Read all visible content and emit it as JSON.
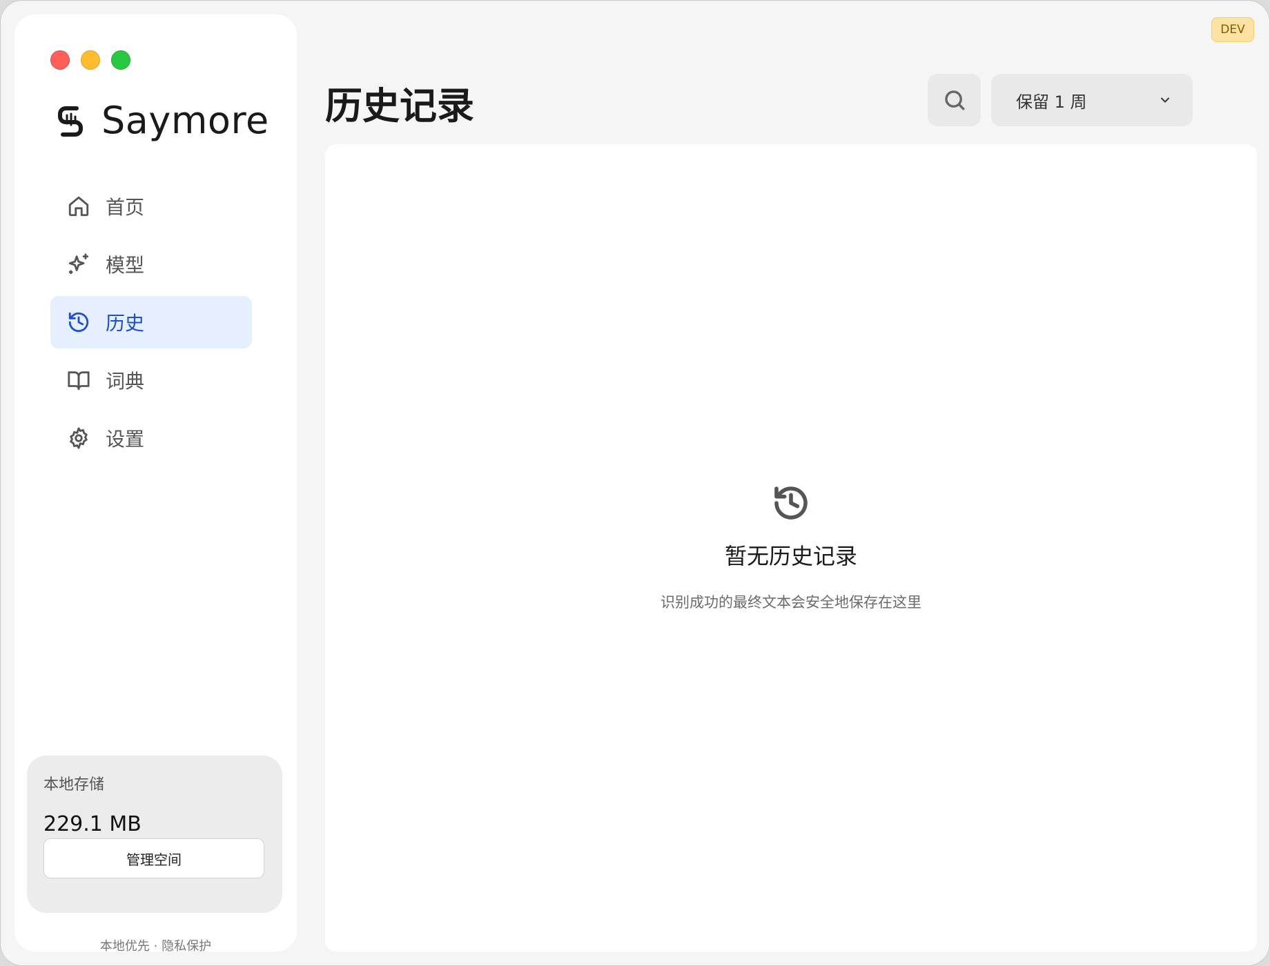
{
  "brand": {
    "name": "Saymore"
  },
  "nav": [
    {
      "label": "首页",
      "icon": "home-icon"
    },
    {
      "label": "模型",
      "icon": "sparkle-icon"
    },
    {
      "label": "历史",
      "icon": "history-icon",
      "active": true
    },
    {
      "label": "词典",
      "icon": "book-icon"
    },
    {
      "label": "设置",
      "icon": "gear-icon"
    }
  ],
  "storage": {
    "label": "本地存储",
    "value": "229.1 MB",
    "button": "管理空间"
  },
  "footer": "本地优先 · 隐私保护",
  "header": {
    "title": "历史记录",
    "retention": "保留 1 周",
    "badge": "DEV"
  },
  "empty": {
    "title": "暂无历史记录",
    "description": "识别成功的最终文本会安全地保存在这里"
  },
  "colors": {
    "accent": "#1b4fd6",
    "active_bg": "#e6effd",
    "badge_bg": "#fde3a3"
  }
}
